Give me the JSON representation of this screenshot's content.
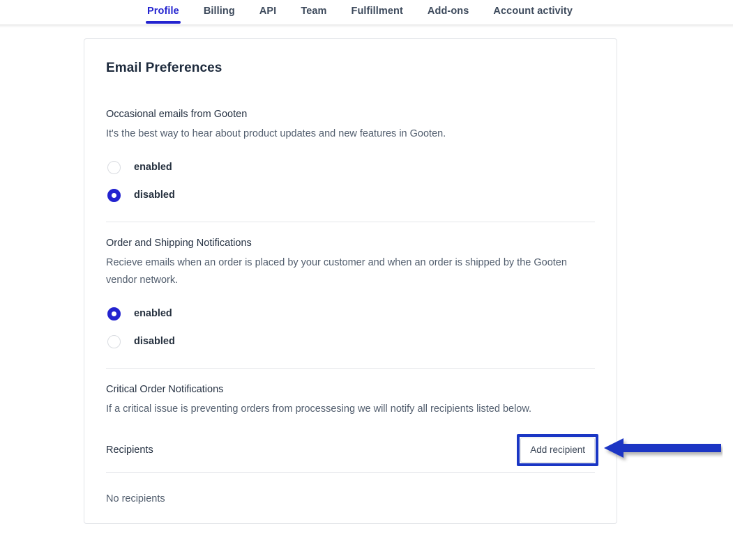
{
  "tabs": [
    {
      "label": "Profile",
      "active": true
    },
    {
      "label": "Billing",
      "active": false
    },
    {
      "label": "API",
      "active": false
    },
    {
      "label": "Team",
      "active": false
    },
    {
      "label": "Fulfillment",
      "active": false
    },
    {
      "label": "Add-ons",
      "active": false
    },
    {
      "label": "Account activity",
      "active": false
    }
  ],
  "card": {
    "title": "Email Preferences",
    "sections": [
      {
        "heading": "Occasional emails from Gooten",
        "description": "It's the best way to hear about product updates and new features in Gooten.",
        "options": [
          {
            "label": "enabled",
            "selected": false
          },
          {
            "label": "disabled",
            "selected": true
          }
        ]
      },
      {
        "heading": "Order and Shipping Notifications",
        "description": "Recieve emails when an order is placed by your customer and when an order is shipped by the Gooten vendor network.",
        "options": [
          {
            "label": "enabled",
            "selected": true
          },
          {
            "label": "disabled",
            "selected": false
          }
        ]
      }
    ],
    "critical": {
      "heading": "Critical Order Notifications",
      "description": "If a critical issue is preventing orders from processesing we will notify all recipients listed below.",
      "recipients_label": "Recipients",
      "add_button_label": "Add recipient",
      "empty_state": "No recipients"
    }
  },
  "annotations": {
    "arrow_icon": "arrow-left-icon",
    "highlight_target": "Add recipient",
    "color": "#1a36c4"
  },
  "colors": {
    "accent": "#2323cf",
    "annotation": "#1a36c4",
    "text_primary": "#243041",
    "text_secondary": "#515d6d",
    "border": "#e2e4e8"
  }
}
